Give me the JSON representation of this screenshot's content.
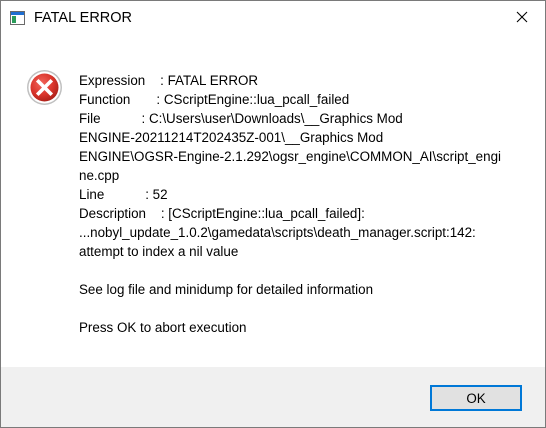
{
  "window": {
    "title": "FATAL ERROR"
  },
  "icons": {
    "app": "app-window-icon",
    "close": "close-icon",
    "error": "error-icon"
  },
  "message": {
    "lines": [
      "Expression    : FATAL ERROR",
      "Function       : CScriptEngine::lua_pcall_failed",
      "File           : C:\\Users\\user\\Downloads\\__Graphics Mod",
      "ENGINE-20211214T202435Z-001\\__Graphics Mod",
      "ENGINE\\OGSR-Engine-2.1.292\\ogsr_engine\\COMMON_AI\\script_engi",
      "ne.cpp",
      "Line           : 52",
      "Description    : [CScriptEngine::lua_pcall_failed]:",
      "...nobyl_update_1.0.2\\gamedata\\scripts\\death_manager.script:142:",
      "attempt to index a nil value",
      "",
      "See log file and minidump for detailed information",
      "",
      "Press OK to abort execution"
    ]
  },
  "buttons": {
    "ok_label": "OK"
  },
  "colors": {
    "error_red": "#d9342b",
    "focus_border": "#0078d7",
    "footer_bg": "#f0f0f0"
  }
}
